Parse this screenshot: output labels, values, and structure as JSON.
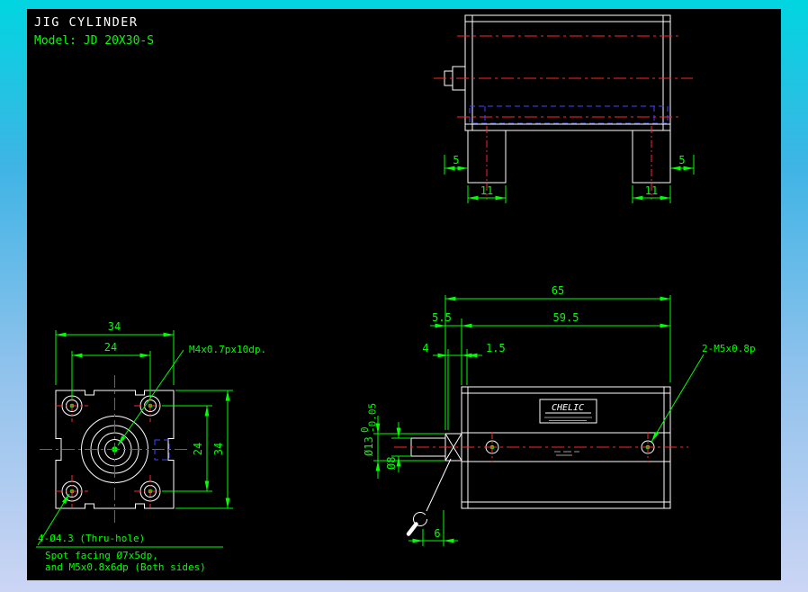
{
  "title_block": {
    "title": "JIG CYLINDER",
    "model": "Model: JD 20X30-S"
  },
  "colors": {
    "canvas": "#000000",
    "outline": "#ffffff",
    "centerline": "#ff2626",
    "hidden_line": "#4545ff",
    "dimension": "#00ff00",
    "desktop_top": "#00d5e0",
    "desktop_bottom": "#ccd5f4"
  },
  "top_view": {
    "dim_left_offset": "5",
    "dim_left_slot": "11",
    "dim_right_slot": "11",
    "dim_right_offset": "5"
  },
  "front_view": {
    "dim_body_width": "34",
    "dim_hole_spacing_h": "24",
    "dim_hole_spacing_v": "24",
    "dim_body_height": "34",
    "note_rod_thread": "M4x0.7px10dp.",
    "note_thru_hole": "4-Ø4.3 (Thru-hole)",
    "note_spot_facing_1": "Spot facing Ø7x5dp,",
    "note_spot_facing_2": "and M5x0.8x6dp (Both sides)"
  },
  "section_view": {
    "dim_total_length": "65",
    "dim_collar": "5.5",
    "dim_body_length": "59.5",
    "dim_step": "4",
    "dim_gap": "1.5",
    "dim_wrench_flat": "6",
    "dim_collar_dia": "Ø13",
    "tol_upper": "0",
    "tol_lower": "-0.05",
    "dim_rod_dia": "Ø8",
    "note_side_thread": "2-M5x0.8p",
    "brand_plate": "CHELIC"
  }
}
